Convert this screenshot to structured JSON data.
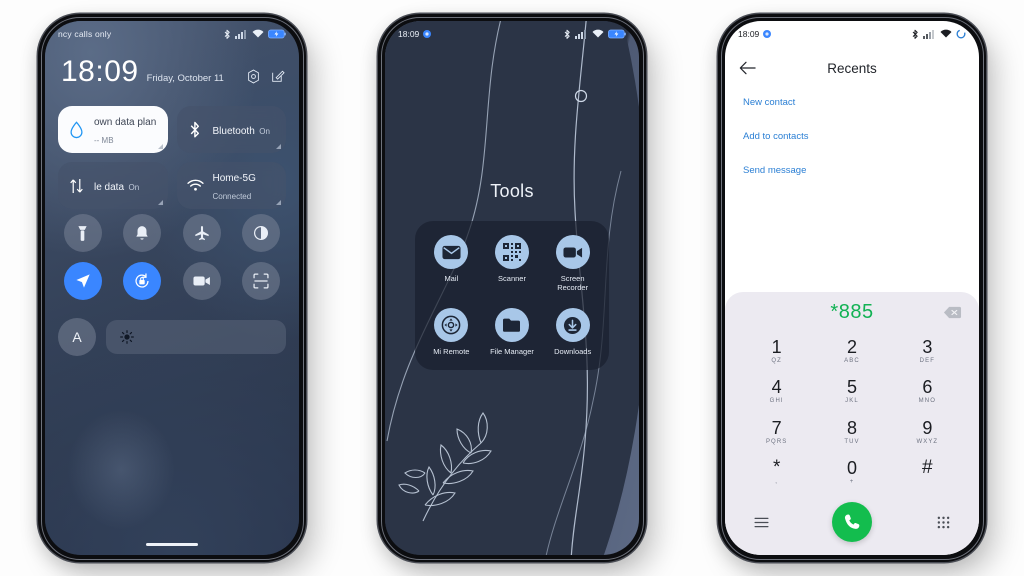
{
  "scene": {
    "background_color": "#fdfdfd",
    "device_count": 3
  },
  "phone1": {
    "name": "control-center",
    "statusbar": {
      "carrier_text": "ncy calls only",
      "icons": [
        "bluetooth-icon",
        "signal-icon",
        "wifi-icon",
        "battery-charging-icon"
      ]
    },
    "clock": {
      "time": "18:09",
      "date": "Friday, October 11",
      "settings_icon": "gear-icon",
      "edit_icon": "edit-icon"
    },
    "big_tiles": [
      {
        "title": "own data plan",
        "subtitle": "-- MB",
        "icon": "water-drop-icon",
        "style": "light",
        "state": "off"
      },
      {
        "title": "Bluetooth",
        "subtitle": "On",
        "icon": "bluetooth-icon",
        "style": "dark",
        "state": "on"
      },
      {
        "title": "le data",
        "subtitle": "On",
        "icon": "mobile-data-icon",
        "style": "dark",
        "state": "on"
      },
      {
        "title": "Home-5G",
        "subtitle": "Connected",
        "icon": "wifi-icon",
        "style": "dark",
        "state": "on"
      }
    ],
    "toggles": [
      {
        "name": "flashlight-icon",
        "active": false
      },
      {
        "name": "ringer-bell-icon",
        "active": false
      },
      {
        "name": "airplane-mode-icon",
        "active": false
      },
      {
        "name": "dark-mode-icon",
        "active": false
      },
      {
        "name": "location-icon",
        "active": true
      },
      {
        "name": "auto-rotate-lock-icon",
        "active": true
      },
      {
        "name": "screen-recorder-icon",
        "active": false
      },
      {
        "name": "scan-icon",
        "active": false
      }
    ],
    "brightness": {
      "auto_label": "A",
      "slider_icon": "sun-icon",
      "level_percent": 8
    },
    "accent_color": "#3a86ff"
  },
  "phone2": {
    "name": "home-screen-folder",
    "statusbar": {
      "time": "18:09",
      "left_icon": "rotation-lock-icon",
      "icons": [
        "bluetooth-icon",
        "signal-icon",
        "wifi-icon",
        "battery-charging-icon"
      ]
    },
    "folder": {
      "title": "Tools",
      "apps": [
        {
          "label": "Mail",
          "icon": "mail-icon"
        },
        {
          "label": "Scanner",
          "icon": "qr-scanner-icon"
        },
        {
          "label": "Screen Recorder",
          "icon": "screen-recorder-icon"
        },
        {
          "label": "Mi Remote",
          "icon": "remote-control-icon"
        },
        {
          "label": "File Manager",
          "icon": "folder-icon"
        },
        {
          "label": "Downloads",
          "icon": "download-icon"
        }
      ]
    },
    "wallpaper": {
      "motif": "botanical-leaf-branch",
      "icon_color": "#a8c7e8",
      "dark_color": "#2b3446",
      "light_color": "#5a6781"
    }
  },
  "phone3": {
    "name": "dialer",
    "statusbar": {
      "time": "18:09",
      "left_icon": "rotation-lock-icon",
      "icons": [
        "bluetooth-icon",
        "signal-icon",
        "wifi-icon",
        "sync-circle-icon"
      ]
    },
    "header": {
      "back_icon": "back-arrow-icon",
      "title": "Recents"
    },
    "links": [
      "New contact",
      "Add to contacts",
      "Send message"
    ],
    "dial": {
      "number": "*885",
      "number_color": "#12b254",
      "backspace_icon": "backspace-icon"
    },
    "keypad": [
      {
        "digit": "1",
        "sub": "QZ"
      },
      {
        "digit": "2",
        "sub": "ABC"
      },
      {
        "digit": "3",
        "sub": "DEF"
      },
      {
        "digit": "4",
        "sub": "GHI"
      },
      {
        "digit": "5",
        "sub": "JKL"
      },
      {
        "digit": "6",
        "sub": "MNO"
      },
      {
        "digit": "7",
        "sub": "PQRS"
      },
      {
        "digit": "8",
        "sub": "TUV"
      },
      {
        "digit": "9",
        "sub": "WXYZ"
      },
      {
        "digit": "*",
        "sub": ","
      },
      {
        "digit": "0",
        "sub": "+"
      },
      {
        "digit": "#",
        "sub": ""
      }
    ],
    "actions": {
      "menu_icon": "menu-icon",
      "call_icon": "phone-call-icon",
      "dialpad_icon": "dialpad-icon",
      "call_button_color": "#13bd4e"
    }
  }
}
